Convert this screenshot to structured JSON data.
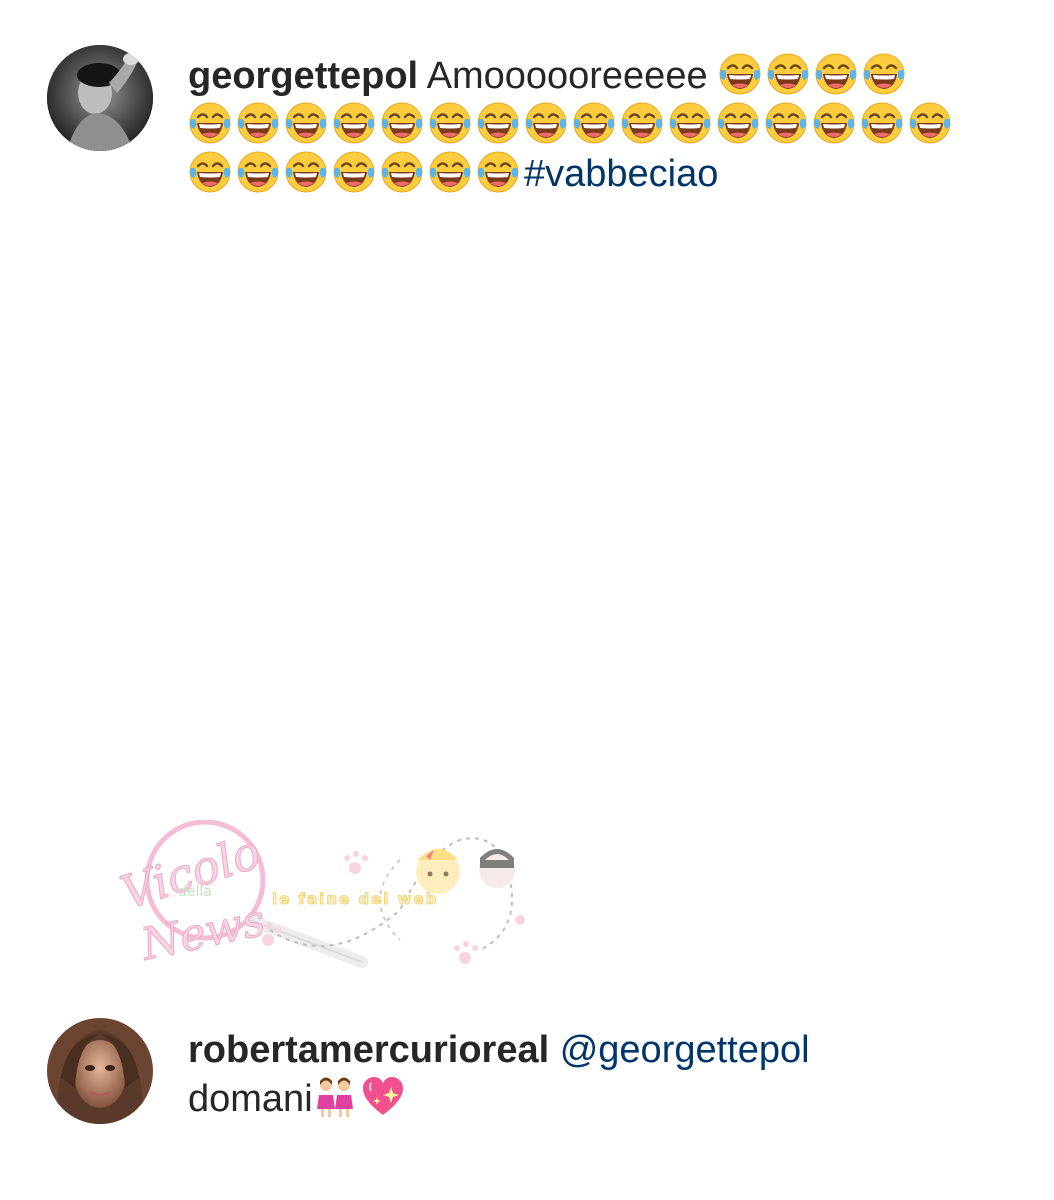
{
  "comments": [
    {
      "username": "georgettepol",
      "text": "Amoooooreeeee",
      "emoji_icon": "face-with-tears-of-joy-icon",
      "emoji_count_line1": 4,
      "emoji_count_line2": 16,
      "emoji_count_line3": 7,
      "hashtag": "#vabbeciao"
    },
    {
      "username": "robertamercurioreal",
      "mention": "@georgettepol",
      "text": "domani",
      "emojis": [
        "two-women-icon",
        "sparkling-heart-icon"
      ]
    }
  ],
  "watermark": {
    "brand": "Vicolo della News",
    "tagline": "le faine del web"
  },
  "colors": {
    "username": "#262626",
    "link": "#003569",
    "background": "#ffffff"
  }
}
